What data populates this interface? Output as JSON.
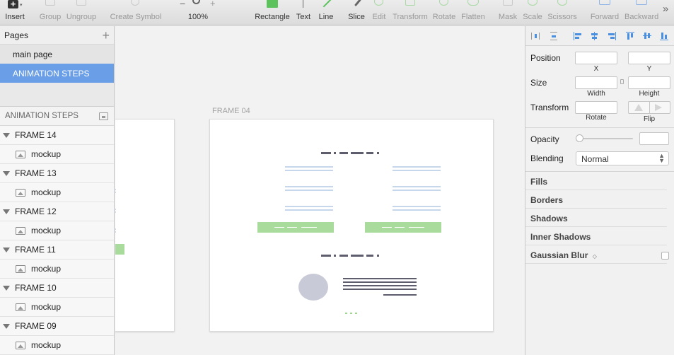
{
  "toolbar": {
    "insert": "Insert",
    "group": "Group",
    "ungroup": "Ungroup",
    "create_symbol": "Create Symbol",
    "zoom_level": "100%",
    "zoom_minus": "−",
    "zoom_plus": "+",
    "rectangle": "Rectangle",
    "text": "Text",
    "line": "Line",
    "slice": "Slice",
    "edit": "Edit",
    "transform": "Transform",
    "rotate": "Rotate",
    "flatten": "Flatten",
    "mask": "Mask",
    "scale": "Scale",
    "scissors": "Scissors",
    "forward": "Forward",
    "backward": "Backward",
    "more": "»",
    "rectangle_color": "#5cc35c"
  },
  "pages": {
    "header": "Pages",
    "add": "+",
    "items": [
      {
        "label": "main page",
        "selected": false
      },
      {
        "label": "ANIMATION STEPS",
        "selected": true
      }
    ],
    "selected_color": "#6a9ee6"
  },
  "layers": {
    "header": "ANIMATION STEPS",
    "items": [
      {
        "label": "FRAME 14",
        "child": "mockup"
      },
      {
        "label": "FRAME 13",
        "child": "mockup"
      },
      {
        "label": "FRAME 12",
        "child": "mockup"
      },
      {
        "label": "FRAME 11",
        "child": "mockup"
      },
      {
        "label": "FRAME 10",
        "child": "mockup"
      },
      {
        "label": "FRAME 09",
        "child": "mockup"
      }
    ]
  },
  "canvas": {
    "artboard_title": "FRAME 04"
  },
  "inspector": {
    "position": "Position",
    "x": "X",
    "y": "Y",
    "size": "Size",
    "width": "Width",
    "height": "Height",
    "transform": "Transform",
    "rotate": "Rotate",
    "flip": "Flip",
    "opacity": "Opacity",
    "blending": "Blending",
    "blending_value": "Normal",
    "fills": "Fills",
    "borders": "Borders",
    "shadows": "Shadows",
    "inner_shadows": "Inner Shadows",
    "gaussian_blur": "Gaussian Blur",
    "accent": "#4a90e2"
  }
}
